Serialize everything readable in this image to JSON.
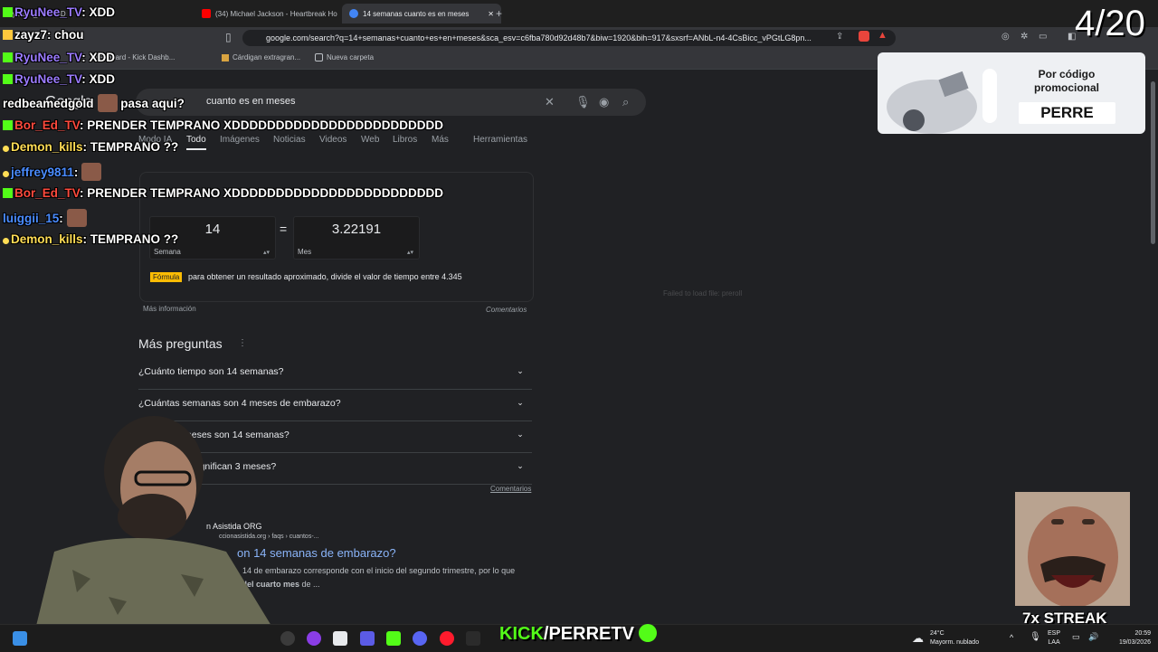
{
  "browser": {
    "tabs": [
      {
        "label": "RyuNee_TV: XDD",
        "active": false
      },
      {
        "label": "(34) Michael Jackson - Heartbreak Ho",
        "active": false
      },
      {
        "label": "14 semanas cuanto es en meses",
        "active": true
      }
    ],
    "url": "google.com/search?q=14+semanas+cuanto+es+en+meses&sca_esv=c6fba780d92d48b7&biw=1920&bih=917&sxsrf=ANbL-n4-4CsBicc_vPGtLG8pn...",
    "bookmarks": [
      "Dashboard - Kick Dashb...",
      "Cárdigan extragran...",
      "Nueva carpeta"
    ]
  },
  "google": {
    "logo": "Google",
    "query": "cuanto es en meses",
    "tabs": [
      "Modo IA",
      "Todo",
      "Imágenes",
      "Noticias",
      "Videos",
      "Web",
      "Libros",
      "Más",
      "Herramientas"
    ],
    "converter": {
      "left_value": "14",
      "left_unit": "Semana",
      "equals": "=",
      "right_value": "3.22191",
      "right_unit": "Mes",
      "formula_tag": "Fórmula",
      "formula_text": "para obtener un resultado aproximado, divide el valor de tiempo entre 4.345",
      "more_info": "Más información",
      "feedback": "Comentarios"
    },
    "paa": {
      "title": "Más preguntas",
      "questions": [
        "¿Cuánto tiempo son 14 semanas?",
        "¿Cuántas semanas son 4 meses de embarazo?",
        "meses son 14 semanas?",
        "significan 3 meses?"
      ],
      "feedback": "Comentarios"
    },
    "result": {
      "site": "n Asistida ORG",
      "crumb": "ccionasistida.org › faqs › cuantos-...",
      "title": "on 14 semanas de embarazo?",
      "snippet_1": "14 de embarazo corresponde con el inicio del segundo trimestre, por lo que",
      "snippet_2_bold": "a del cuarto mes",
      "snippet_2_tail": " de ..."
    },
    "failed_msg": "Failed to load file: preroll"
  },
  "chat": [
    {
      "user": "RyuNee_TV",
      "msg": "XDD",
      "color": "#9b7bff"
    },
    {
      "user": "zayz7",
      "msg": "chou",
      "color": "#ffffff"
    },
    {
      "user": "RyuNee_TV",
      "msg": "XDD",
      "color": "#9b7bff"
    },
    {
      "user": "RyuNee_TV",
      "msg": "XDD",
      "color": "#9b7bff"
    },
    {
      "user": "redbeamedgold",
      "msg": "pasa aqui?",
      "color": "#ffffff"
    },
    {
      "user": "Bor_Ed_TV",
      "msg": "PRENDER TEMPRANO XDDDDDDDDDDDDDDDDDDDDDDDD",
      "color": "#ff4a3d"
    },
    {
      "user": "Demon_kills",
      "msg": "TEMPRANO ??",
      "color": "#ffdd55"
    },
    {
      "user": "jeffrey9811",
      "msg": "",
      "color": "#4a8cff"
    },
    {
      "user": "Bor_Ed_TV",
      "msg": "PRENDER TEMPRANO XDDDDDDDDDDDDDDDDDDDDDDDD",
      "color": "#ff4a3d"
    },
    {
      "user": "luiggii_15",
      "msg": "",
      "color": "#4a8cff"
    },
    {
      "user": "Demon_kills",
      "msg": "TEMPRANO ??",
      "color": "#ffdd55"
    }
  ],
  "overlay": {
    "counter": "4/20",
    "promo_line1": "Por código",
    "promo_line2": "promocional",
    "promo_code": "PERRE",
    "streak": "7x STREAK",
    "kick_brand": "KICK",
    "kick_channel": "/PERRETV"
  },
  "taskbar": {
    "weather_temp": "24°C",
    "weather_desc": "Mayorm. nublado",
    "lang1": "ESP",
    "lang2": "LAA",
    "time": "20:59",
    "date": "19/03/2026"
  },
  "colors": {
    "accent": "#8ab4f8",
    "kick_green": "#53fc18",
    "page_bg": "#202124"
  }
}
